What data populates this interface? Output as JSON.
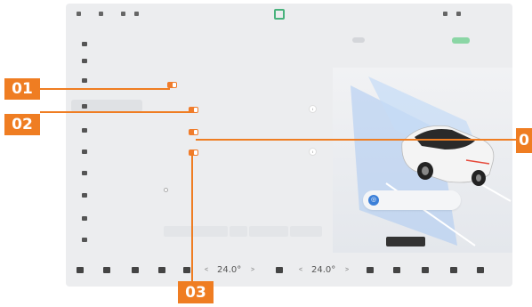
{
  "status_bar": {
    "left_items": [
      "",
      "",
      ""
    ],
    "right_items": [
      "",
      "",
      ""
    ]
  },
  "sidebar": {
    "items": [
      {
        "label": "",
        "active": false
      },
      {
        "label": "",
        "active": false
      },
      {
        "label": "",
        "active": false
      },
      {
        "label": "",
        "active": true
      },
      {
        "label": "",
        "active": false
      },
      {
        "label": "",
        "active": false
      },
      {
        "label": "",
        "active": false
      },
      {
        "label": "",
        "active": false
      },
      {
        "label": "",
        "active": false
      },
      {
        "label": "",
        "active": false
      }
    ]
  },
  "tabs": [
    {
      "label": "",
      "active": false
    },
    {
      "label": "",
      "active": false
    },
    {
      "label": "",
      "active": true
    }
  ],
  "settings": {
    "section_label": "",
    "main_toggle_label": "",
    "sub_toggle_1_label": "",
    "sub_toggle_2_label": "",
    "sub_toggle_3_label": "",
    "warning_label": "",
    "radio_label": "",
    "sensitivity_label": "",
    "options": [
      "",
      "",
      "",
      ""
    ]
  },
  "notice": {
    "text": ""
  },
  "dark_button": {
    "label": ""
  },
  "bottom_bar": {
    "temp_left": "24.0°",
    "temp_right": "24.0°",
    "left_minus": "<",
    "left_plus": ">",
    "right_minus": "<",
    "right_plus": ">"
  },
  "callouts": {
    "c01": "01",
    "c02": "02",
    "c03": "03",
    "c04": "0"
  },
  "colors": {
    "accent": "#ef7d22",
    "toggle_on": "#f07c2b",
    "screen_bg": "#ecedef"
  }
}
